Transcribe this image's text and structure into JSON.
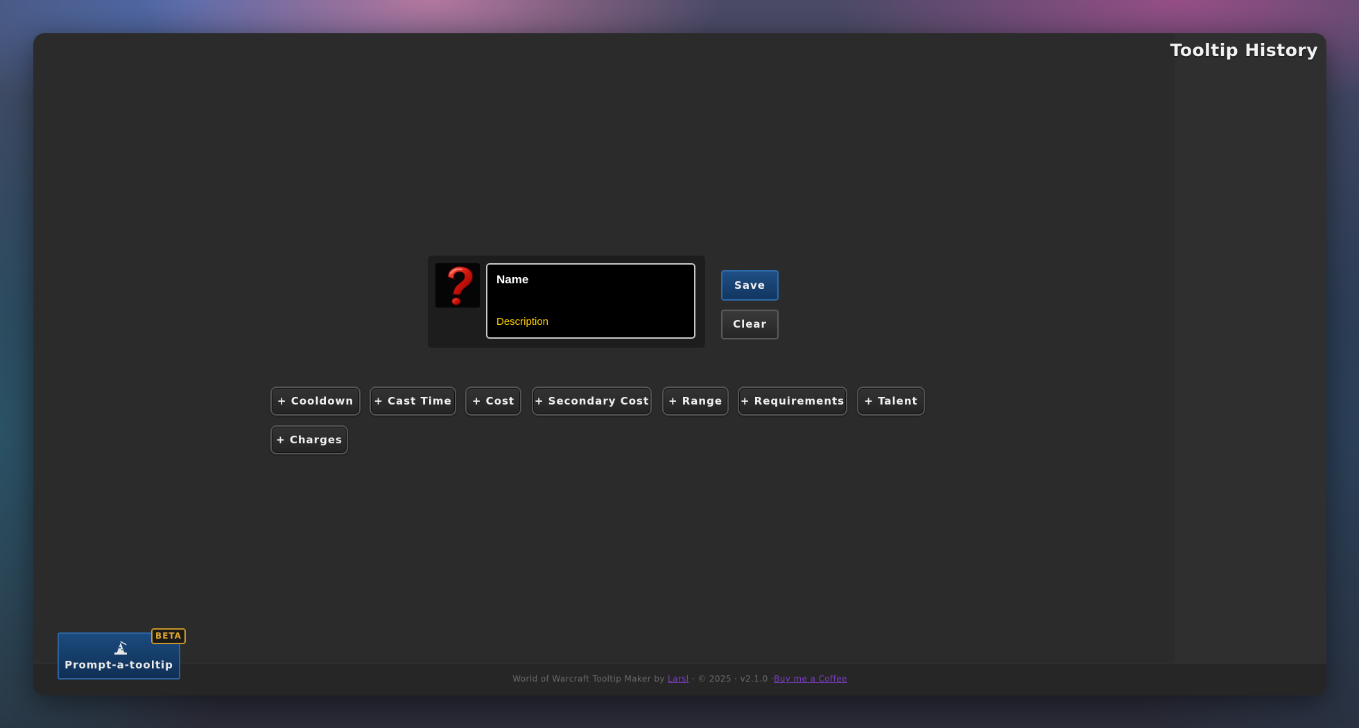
{
  "sidebar": {
    "title": "Tooltip History"
  },
  "tooltip": {
    "icon": "question-mark-icon",
    "name": "Name",
    "description": "Description"
  },
  "actions": {
    "save_label": "Save",
    "clear_label": "Clear"
  },
  "add_buttons": [
    "+ Cooldown",
    "+ Cast Time",
    "+ Cost",
    "+ Secondary Cost",
    "+ Range",
    "+ Requirements",
    "+ Talent",
    "+ Charges"
  ],
  "prompt": {
    "label": "Prompt-a-tooltip",
    "badge": "BETA",
    "icon": "wizard-hat-icon"
  },
  "footer": {
    "text_before": "World of Warcraft Tooltip Maker by ",
    "author": "Larsl",
    "text_middle": " · © 2025 · v2.1.0 ·",
    "coffee": "Buy me a Coffee"
  },
  "colors": {
    "accent_blue": "#1b4b7e",
    "tooltip_description": "#ffd100",
    "beta_badge": "#e0a62a",
    "link": "#7a3fc0"
  }
}
